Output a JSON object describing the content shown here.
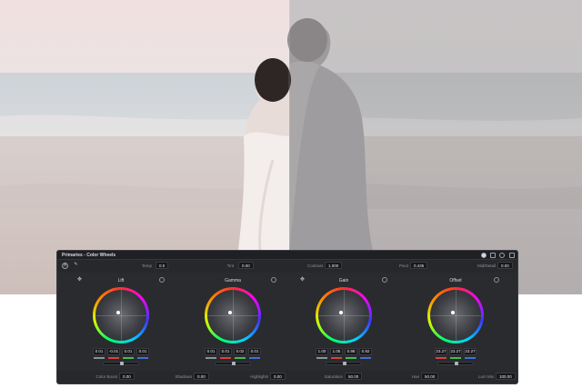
{
  "panel": {
    "title": "Primaries - Color Wheels"
  },
  "params_top": [
    {
      "label": "Temp",
      "value": "0.0"
    },
    {
      "label": "Tint",
      "value": "0.00"
    },
    {
      "label": "Contrast",
      "value": "1.000"
    },
    {
      "label": "Pivot",
      "value": "0.435"
    },
    {
      "label": "Mid/Detail",
      "value": "0.00"
    }
  ],
  "wheels": [
    {
      "name": "Lift",
      "values": [
        "0.01",
        "-0.01",
        "0.01",
        "0.01"
      ]
    },
    {
      "name": "Gamma",
      "values": [
        "0.01",
        "0.01",
        "0.02",
        "0.01"
      ]
    },
    {
      "name": "Gain",
      "values": [
        "1.00",
        "1.05",
        "0.98",
        "0.92"
      ]
    },
    {
      "name": "Offset",
      "values": [
        "23.27",
        "23.27",
        "23.27",
        ""
      ]
    }
  ],
  "params_bottom": [
    {
      "label": "Color Boost",
      "value": "0.00"
    },
    {
      "label": "Shadows",
      "value": "0.00"
    },
    {
      "label": "Highlights",
      "value": "0.00"
    },
    {
      "label": "Saturation",
      "value": "50.00"
    },
    {
      "label": "Hue",
      "value": "50.00"
    },
    {
      "label": "Lum Mix",
      "value": "100.00"
    }
  ],
  "colors": {
    "panel_bg": "#27282c",
    "channel_red": "#d9413f",
    "channel_green": "#3fbf55",
    "channel_blue": "#3f6fd9"
  },
  "icons": [
    "auto-balance-icon",
    "picker-icon",
    "reset-icon",
    "wheel-mode-icon",
    "bars-mode-icon",
    "log-mode-icon",
    "menu-icon"
  ]
}
